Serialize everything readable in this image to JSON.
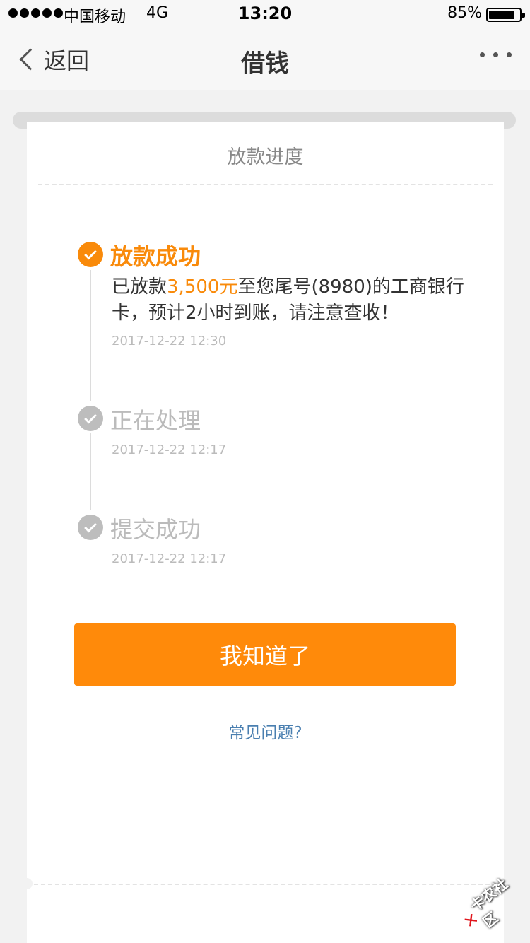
{
  "status_bar": {
    "carrier": "中国移动",
    "network": "4G",
    "time": "13:20",
    "battery": "85%",
    "battery_level": 0.85
  },
  "nav": {
    "back_label": "返回",
    "title": "借钱"
  },
  "card": {
    "header": "放款进度"
  },
  "steps": [
    {
      "title": "放款成功",
      "desc_prefix": "已放款",
      "amount": "3,500元",
      "desc_suffix": "至您尾号(8980)的工商银行卡，预计2小时到账，请注意查收！",
      "time": "2017-12-22 12:30",
      "active": true
    },
    {
      "title": "正在处理",
      "time": "2017-12-22 12:17",
      "active": false
    },
    {
      "title": "提交成功",
      "time": "2017-12-22 12:17",
      "active": false
    }
  ],
  "confirm_button": "我知道了",
  "faq_link": "常见问题?",
  "watermark": "卡农社区",
  "colors": {
    "accent": "#ff8a0a",
    "link": "#4a7fb0",
    "inactive": "#bdbdbd"
  }
}
